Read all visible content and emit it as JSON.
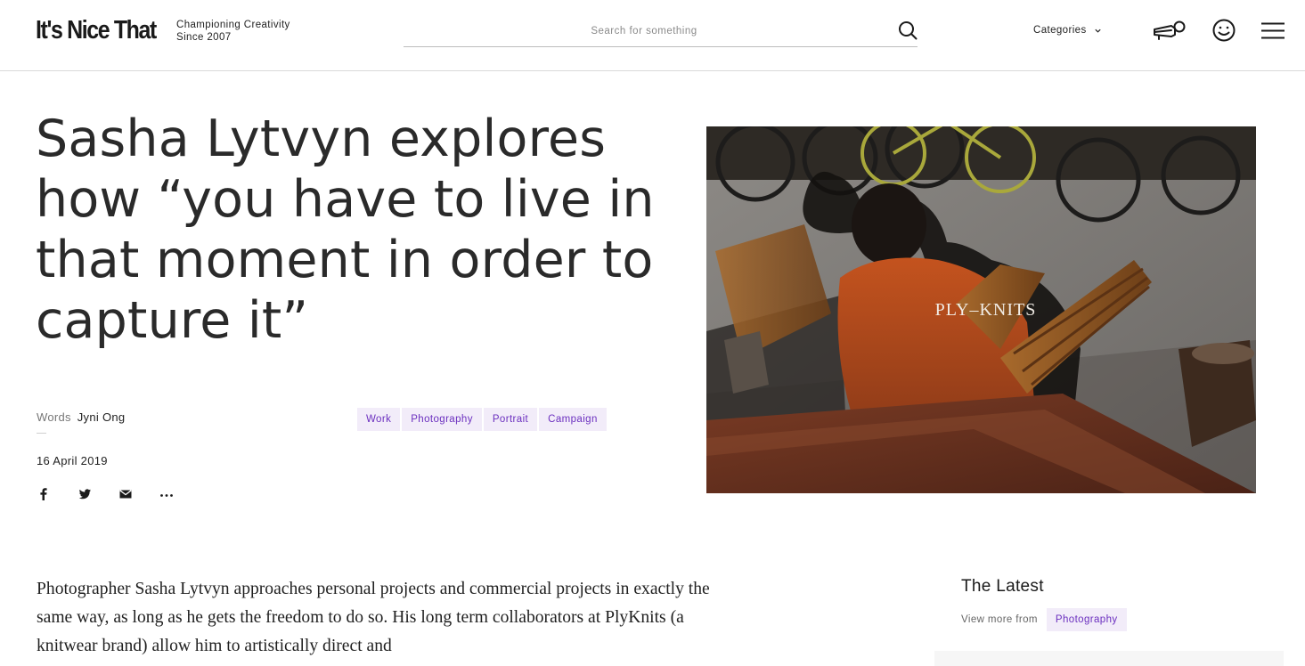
{
  "header": {
    "logo": "It's Nice That",
    "tagline_line1": "Championing Creativity",
    "tagline_line2": "Since 2007",
    "search_placeholder": "Search for something",
    "categories_label": "Categories"
  },
  "article": {
    "title": "Sasha Lytvyn explores how “you have to live in that moment in order to capture it”",
    "words_label": "Words",
    "author": "Jyni Ong",
    "date": "16 April 2019",
    "tags": [
      "Work",
      "Photography",
      "Portrait",
      "Campaign"
    ],
    "share_icons": [
      "facebook-icon",
      "twitter-icon",
      "email-icon",
      "more-icon"
    ],
    "hero_label": "PLY–KNITS",
    "body": "Photographer Sasha Lytvyn approaches personal projects and commercial projects in exactly the same way, as long as he gets the freedom to do so. His long term collaborators at PlyKnits (a knitwear brand) allow him to artistically direct and"
  },
  "sidebar": {
    "latest_title": "The Latest",
    "view_more_label": "View more from",
    "view_more_tag": "Photography"
  },
  "colors": {
    "accent": "#6b2fbf",
    "tag_background": "#f2ecf9",
    "text": "#2a2a2a"
  }
}
